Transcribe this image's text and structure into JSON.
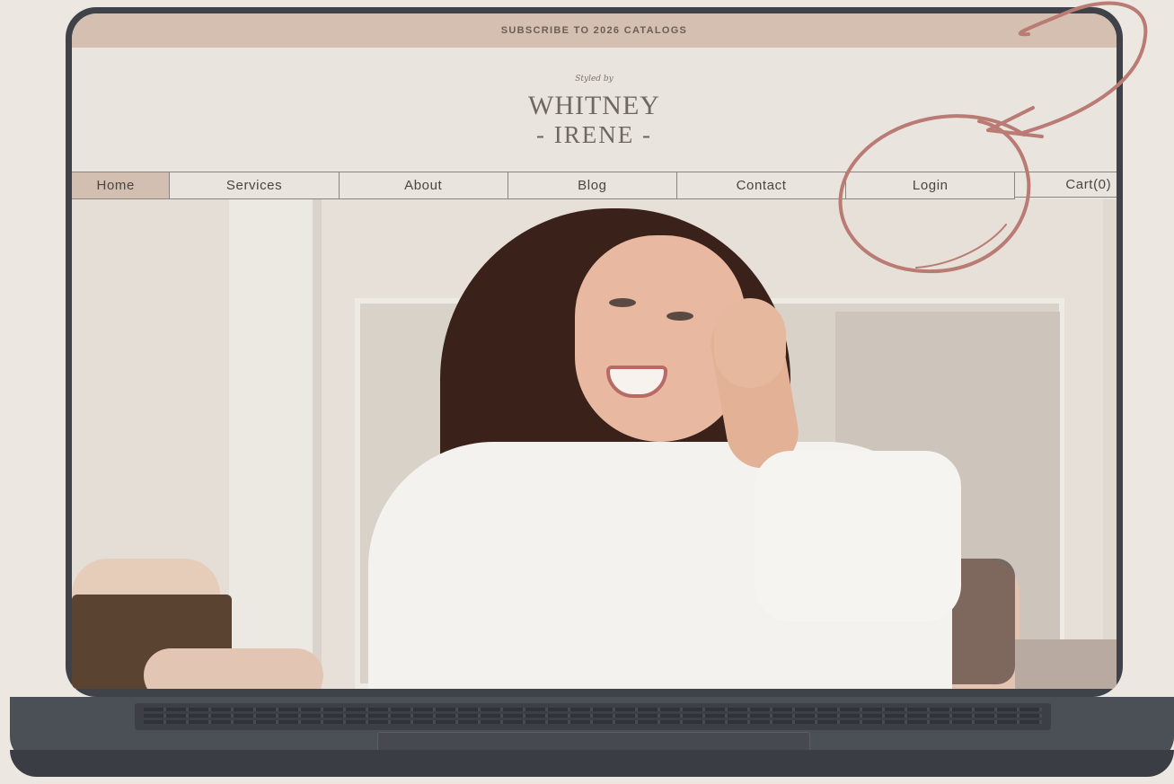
{
  "promo": {
    "text": "SUBSCRIBE TO 2026 CATALOGS"
  },
  "brand": {
    "styled_by": "Styled by",
    "name_first": "WHITNEY",
    "name_second": "- IRENE -"
  },
  "nav": {
    "items": [
      {
        "label": "Home"
      },
      {
        "label": "Services"
      },
      {
        "label": "About"
      },
      {
        "label": "Blog"
      },
      {
        "label": "Contact"
      },
      {
        "label": "Login"
      },
      {
        "label": "Cart(0)"
      }
    ]
  },
  "colors": {
    "accent": "#d4bfb1",
    "annotation": "#b97b73",
    "device": "#3f4349"
  },
  "icons": {
    "annotation": "hand-drawn-circle-arrow-icon"
  }
}
